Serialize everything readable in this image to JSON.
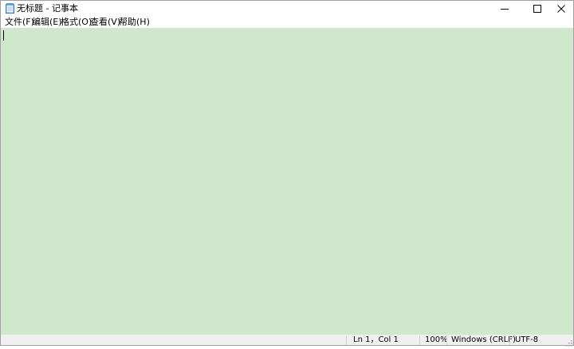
{
  "window": {
    "title": "无标题 - 记事本",
    "icon": "notepad-icon"
  },
  "menu": [
    {
      "label": "文件(F)"
    },
    {
      "label": "编辑(E)"
    },
    {
      "label": "格式(O)"
    },
    {
      "label": "查看(V)"
    },
    {
      "label": "帮助(H)"
    }
  ],
  "editor": {
    "content": "",
    "background_color": "#cfe8cc"
  },
  "status": {
    "position": "Ln 1，Col 1",
    "zoom": "100%",
    "line_ending": "Windows (CRLF)",
    "encoding": "UTF-8"
  }
}
